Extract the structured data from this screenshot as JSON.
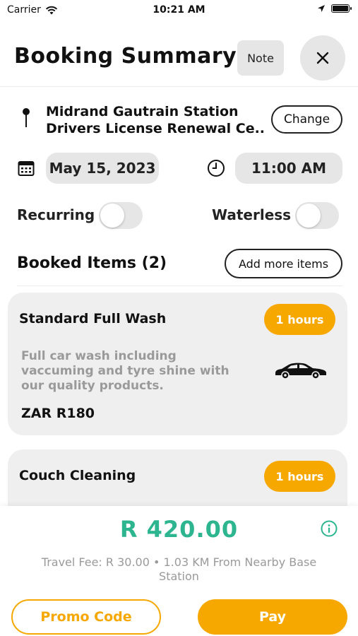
{
  "status_bar": {
    "carrier": "Carrier",
    "time": "10:21 AM"
  },
  "header": {
    "title": "Booking Summary",
    "note_label": "Note"
  },
  "location": {
    "line1": "Midrand Gautrain Station",
    "line2": "Drivers License Renewal Ce...",
    "change_label": "Change"
  },
  "schedule": {
    "date": "May 15, 2023",
    "time": "11:00 AM"
  },
  "toggles": {
    "recurring": {
      "label": "Recurring",
      "on": false
    },
    "waterless": {
      "label": "Waterless",
      "on": false
    }
  },
  "booked": {
    "title": "Booked Items (2)",
    "add_label": "Add more items"
  },
  "items": [
    {
      "name": "Standard Full Wash",
      "duration": "1 hours",
      "description": "Full car wash including vaccuming and tyre shine with our quality products.",
      "price": "ZAR R180",
      "icon": "car-icon"
    },
    {
      "name": "Couch Cleaning",
      "duration": "1 hours"
    }
  ],
  "footer": {
    "total": "R 420.00",
    "travel_fee": "Travel Fee: R 30.00 • 1.03 KM From Nearby Base Station",
    "promo_label": "Promo Code",
    "pay_label": "Pay"
  },
  "colors": {
    "accent": "#f7a800",
    "total": "#2db58f",
    "muted": "#9a9a9a",
    "pill": "#e6e6e6"
  }
}
